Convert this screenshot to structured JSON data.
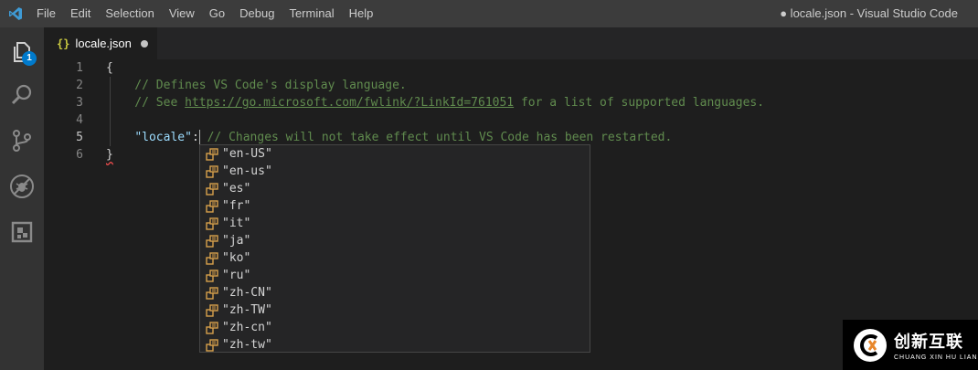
{
  "menu": [
    "File",
    "Edit",
    "Selection",
    "View",
    "Go",
    "Debug",
    "Terminal",
    "Help"
  ],
  "window_title": "● locale.json - Visual Studio Code",
  "activity": {
    "badge": "1"
  },
  "tab": {
    "icon": "{}",
    "label": "locale.json"
  },
  "editor": {
    "active_line": 5,
    "lines": [
      {
        "num": "1",
        "parts": [
          {
            "t": "{",
            "c": "punc"
          }
        ]
      },
      {
        "num": "2",
        "parts": [
          {
            "t": "    // Defines VS Code's display language.",
            "c": "comment"
          }
        ]
      },
      {
        "num": "3",
        "parts": [
          {
            "t": "    // See ",
            "c": "comment"
          },
          {
            "t": "https://go.microsoft.com/fwlink/?LinkId=761051",
            "c": "link"
          },
          {
            "t": " for a list of supported languages.",
            "c": "comment"
          }
        ]
      },
      {
        "num": "4",
        "parts": []
      },
      {
        "num": "5",
        "parts": [
          {
            "t": "    ",
            "c": "punc"
          },
          {
            "t": "\"locale\"",
            "c": "key"
          },
          {
            "t": ":",
            "c": "punc"
          },
          {
            "t": "",
            "c": "cursor"
          },
          {
            "t": " // Changes will not take effect until VS Code has been restarted.",
            "c": "comment"
          }
        ]
      },
      {
        "num": "6",
        "parts": [
          {
            "t": "}",
            "c": "punc squiggle"
          }
        ]
      }
    ]
  },
  "suggestions": [
    "\"en-US\"",
    "\"en-us\"",
    "\"es\"",
    "\"fr\"",
    "\"it\"",
    "\"ja\"",
    "\"ko\"",
    "\"ru\"",
    "\"zh-CN\"",
    "\"zh-TW\"",
    "\"zh-cn\"",
    "\"zh-tw\""
  ],
  "watermark": {
    "cn": "创新互联",
    "en": "CHUANG XIN HU LIAN"
  },
  "colors": {
    "accent": "#007acc",
    "suggest_icon": "#d7a04b",
    "comment": "#608b4e",
    "key": "#9cdcfe"
  }
}
